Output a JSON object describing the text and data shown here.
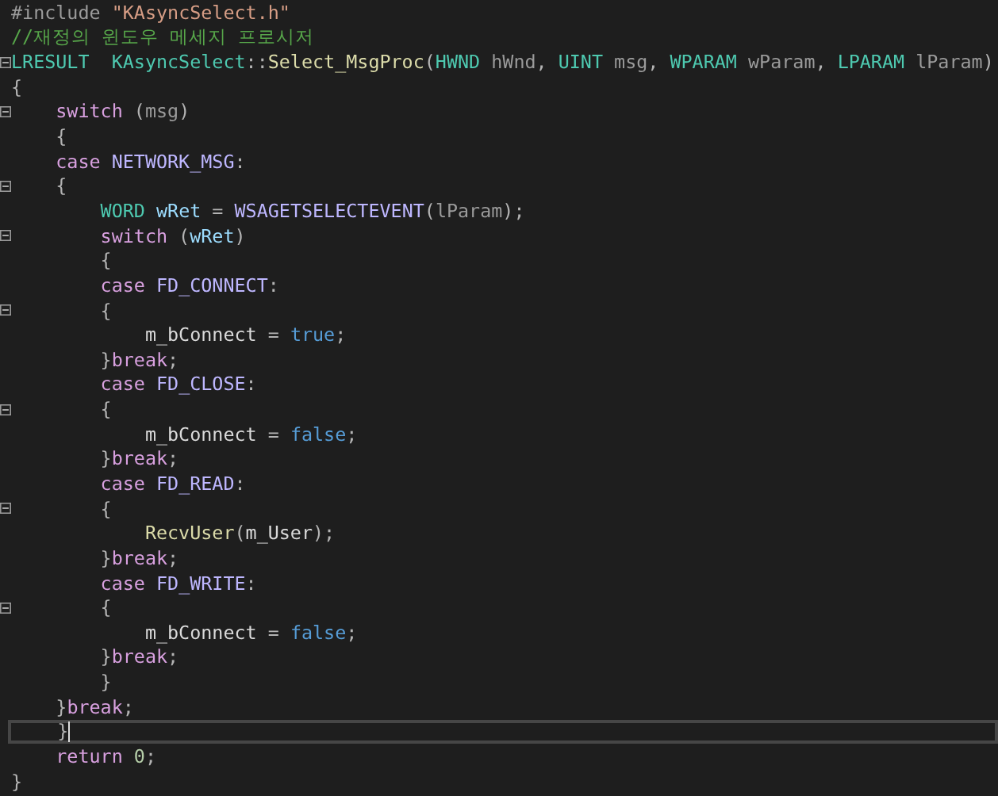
{
  "lines": [
    {
      "foldable": false,
      "current": false,
      "tokens": [
        {
          "kind": "preproc",
          "text": "#include "
        },
        {
          "kind": "str",
          "text": "\"KAsyncSelect.h\""
        }
      ]
    },
    {
      "foldable": false,
      "current": false,
      "tokens": [
        {
          "kind": "comment",
          "text": "//재정의 윈도우 메세지 프로시저"
        }
      ]
    },
    {
      "foldable": true,
      "current": false,
      "tokens": [
        {
          "kind": "type",
          "text": "LRESULT"
        },
        {
          "kind": "type",
          "text": "  KAsyncSelect"
        },
        {
          "kind": "punc",
          "text": "::"
        },
        {
          "kind": "fn",
          "text": "Select_MsgProc"
        },
        {
          "kind": "punc",
          "text": "("
        },
        {
          "kind": "type",
          "text": "HWND"
        },
        {
          "kind": "param",
          "text": " hWnd"
        },
        {
          "kind": "punc",
          "text": ", "
        },
        {
          "kind": "type",
          "text": "UINT"
        },
        {
          "kind": "param",
          "text": " msg"
        },
        {
          "kind": "punc",
          "text": ", "
        },
        {
          "kind": "type",
          "text": "WPARAM"
        },
        {
          "kind": "param",
          "text": " wParam"
        },
        {
          "kind": "punc",
          "text": ", "
        },
        {
          "kind": "type",
          "text": "LPARAM"
        },
        {
          "kind": "param",
          "text": " lParam"
        },
        {
          "kind": "punc",
          "text": ")"
        }
      ]
    },
    {
      "foldable": false,
      "current": false,
      "tokens": [
        {
          "kind": "punc",
          "text": "{"
        }
      ]
    },
    {
      "foldable": true,
      "current": false,
      "tokens": [
        {
          "kind": "kw",
          "text": "    switch"
        },
        {
          "kind": "punc",
          "text": " ("
        },
        {
          "kind": "param",
          "text": "msg"
        },
        {
          "kind": "punc",
          "text": ")"
        }
      ]
    },
    {
      "foldable": false,
      "current": false,
      "tokens": [
        {
          "kind": "punc",
          "text": "    {"
        }
      ]
    },
    {
      "foldable": false,
      "current": false,
      "tokens": [
        {
          "kind": "kw",
          "text": "    case"
        },
        {
          "kind": "macro",
          "text": " NETWORK_MSG"
        },
        {
          "kind": "punc",
          "text": ":"
        }
      ]
    },
    {
      "foldable": true,
      "current": false,
      "tokens": [
        {
          "kind": "punc",
          "text": "    {"
        }
      ]
    },
    {
      "foldable": false,
      "current": false,
      "tokens": [
        {
          "kind": "type",
          "text": "        WORD"
        },
        {
          "kind": "local",
          "text": " wRet"
        },
        {
          "kind": "punc",
          "text": " = "
        },
        {
          "kind": "macro",
          "text": "WSAGETSELECTEVENT"
        },
        {
          "kind": "punc",
          "text": "("
        },
        {
          "kind": "param",
          "text": "lParam"
        },
        {
          "kind": "punc",
          "text": ");"
        }
      ]
    },
    {
      "foldable": true,
      "current": false,
      "tokens": [
        {
          "kind": "kw",
          "text": "        switch"
        },
        {
          "kind": "punc",
          "text": " ("
        },
        {
          "kind": "local",
          "text": "wRet"
        },
        {
          "kind": "punc",
          "text": ")"
        }
      ]
    },
    {
      "foldable": false,
      "current": false,
      "tokens": [
        {
          "kind": "punc",
          "text": "        {"
        }
      ]
    },
    {
      "foldable": false,
      "current": false,
      "tokens": [
        {
          "kind": "kw",
          "text": "        case"
        },
        {
          "kind": "macro",
          "text": " FD_CONNECT"
        },
        {
          "kind": "punc",
          "text": ":"
        }
      ]
    },
    {
      "foldable": true,
      "current": false,
      "tokens": [
        {
          "kind": "punc",
          "text": "        {"
        }
      ]
    },
    {
      "foldable": false,
      "current": false,
      "tokens": [
        {
          "kind": "plain",
          "text": "            m_bConnect"
        },
        {
          "kind": "punc",
          "text": " = "
        },
        {
          "kind": "lit",
          "text": "true"
        },
        {
          "kind": "punc",
          "text": ";"
        }
      ]
    },
    {
      "foldable": false,
      "current": false,
      "tokens": [
        {
          "kind": "punc",
          "text": "        }"
        },
        {
          "kind": "kw",
          "text": "break"
        },
        {
          "kind": "punc",
          "text": ";"
        }
      ]
    },
    {
      "foldable": false,
      "current": false,
      "tokens": [
        {
          "kind": "kw",
          "text": "        case"
        },
        {
          "kind": "macro",
          "text": " FD_CLOSE"
        },
        {
          "kind": "punc",
          "text": ":"
        }
      ]
    },
    {
      "foldable": true,
      "current": false,
      "tokens": [
        {
          "kind": "punc",
          "text": "        {"
        }
      ]
    },
    {
      "foldable": false,
      "current": false,
      "tokens": [
        {
          "kind": "plain",
          "text": "            m_bConnect"
        },
        {
          "kind": "punc",
          "text": " = "
        },
        {
          "kind": "lit",
          "text": "false"
        },
        {
          "kind": "punc",
          "text": ";"
        }
      ]
    },
    {
      "foldable": false,
      "current": false,
      "tokens": [
        {
          "kind": "punc",
          "text": "        }"
        },
        {
          "kind": "kw",
          "text": "break"
        },
        {
          "kind": "punc",
          "text": ";"
        }
      ]
    },
    {
      "foldable": false,
      "current": false,
      "tokens": [
        {
          "kind": "kw",
          "text": "        case"
        },
        {
          "kind": "macro",
          "text": " FD_READ"
        },
        {
          "kind": "punc",
          "text": ":"
        }
      ]
    },
    {
      "foldable": true,
      "current": false,
      "tokens": [
        {
          "kind": "punc",
          "text": "        {"
        }
      ]
    },
    {
      "foldable": false,
      "current": false,
      "tokens": [
        {
          "kind": "fn",
          "text": "            RecvUser"
        },
        {
          "kind": "punc",
          "text": "("
        },
        {
          "kind": "plain",
          "text": "m_User"
        },
        {
          "kind": "punc",
          "text": ");"
        }
      ]
    },
    {
      "foldable": false,
      "current": false,
      "tokens": [
        {
          "kind": "punc",
          "text": "        }"
        },
        {
          "kind": "kw",
          "text": "break"
        },
        {
          "kind": "punc",
          "text": ";"
        }
      ]
    },
    {
      "foldable": false,
      "current": false,
      "tokens": [
        {
          "kind": "kw",
          "text": "        case"
        },
        {
          "kind": "macro",
          "text": " FD_WRITE"
        },
        {
          "kind": "punc",
          "text": ":"
        }
      ]
    },
    {
      "foldable": true,
      "current": false,
      "tokens": [
        {
          "kind": "punc",
          "text": "        {"
        }
      ]
    },
    {
      "foldable": false,
      "current": false,
      "tokens": [
        {
          "kind": "plain",
          "text": "            m_bConnect"
        },
        {
          "kind": "punc",
          "text": " = "
        },
        {
          "kind": "lit",
          "text": "false"
        },
        {
          "kind": "punc",
          "text": ";"
        }
      ]
    },
    {
      "foldable": false,
      "current": false,
      "tokens": [
        {
          "kind": "punc",
          "text": "        }"
        },
        {
          "kind": "kw",
          "text": "break"
        },
        {
          "kind": "punc",
          "text": ";"
        }
      ]
    },
    {
      "foldable": false,
      "current": false,
      "tokens": [
        {
          "kind": "punc",
          "text": "        }"
        }
      ]
    },
    {
      "foldable": false,
      "current": false,
      "tokens": [
        {
          "kind": "punc",
          "text": "    }"
        },
        {
          "kind": "kw",
          "text": "break"
        },
        {
          "kind": "punc",
          "text": ";"
        }
      ]
    },
    {
      "foldable": false,
      "current": true,
      "tokens": [
        {
          "kind": "punc",
          "text": "    }"
        }
      ]
    },
    {
      "foldable": false,
      "current": false,
      "tokens": [
        {
          "kind": "kw",
          "text": "    return"
        },
        {
          "kind": "num",
          "text": " 0"
        },
        {
          "kind": "punc",
          "text": ";"
        }
      ]
    },
    {
      "foldable": false,
      "current": false,
      "tokens": [
        {
          "kind": "punc",
          "text": "}"
        }
      ]
    }
  ]
}
